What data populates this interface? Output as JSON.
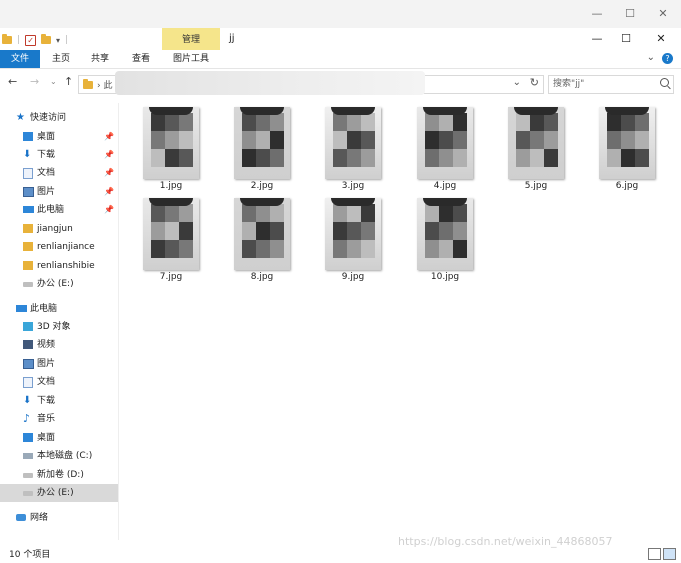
{
  "ribbon": {
    "context_group": "管理",
    "title": "jj",
    "tabs": [
      "文件",
      "主页",
      "共享",
      "查看",
      "图片工具"
    ]
  },
  "nav": {
    "breadcrumb_visible": "此",
    "search_placeholder": "搜索\"jj\""
  },
  "sidebar": {
    "quick_access": "快速访问",
    "quick_items": [
      "桌面",
      "下载",
      "文档",
      "图片",
      "此电脑",
      "jiangjun",
      "renlianjiance",
      "renlianshibie",
      "办公 (E:)"
    ],
    "this_pc": "此电脑",
    "pc_items": [
      "3D 对象",
      "视频",
      "图片",
      "文档",
      "下载",
      "音乐",
      "桌面",
      "本地磁盘 (C:)",
      "新加卷 (D:)",
      "办公 (E:)"
    ],
    "network": "网络"
  },
  "files": [
    "1.jpg",
    "2.jpg",
    "3.jpg",
    "4.jpg",
    "5.jpg",
    "6.jpg",
    "7.jpg",
    "8.jpg",
    "9.jpg",
    "10.jpg"
  ],
  "status": {
    "count": "10 个项目"
  },
  "watermark": "https://blog.csdn.net/weixin_44868057",
  "colors": {
    "file_tab": "#1979ca",
    "context_tab": "#f5e58b",
    "selected": "#d9d9d9"
  }
}
